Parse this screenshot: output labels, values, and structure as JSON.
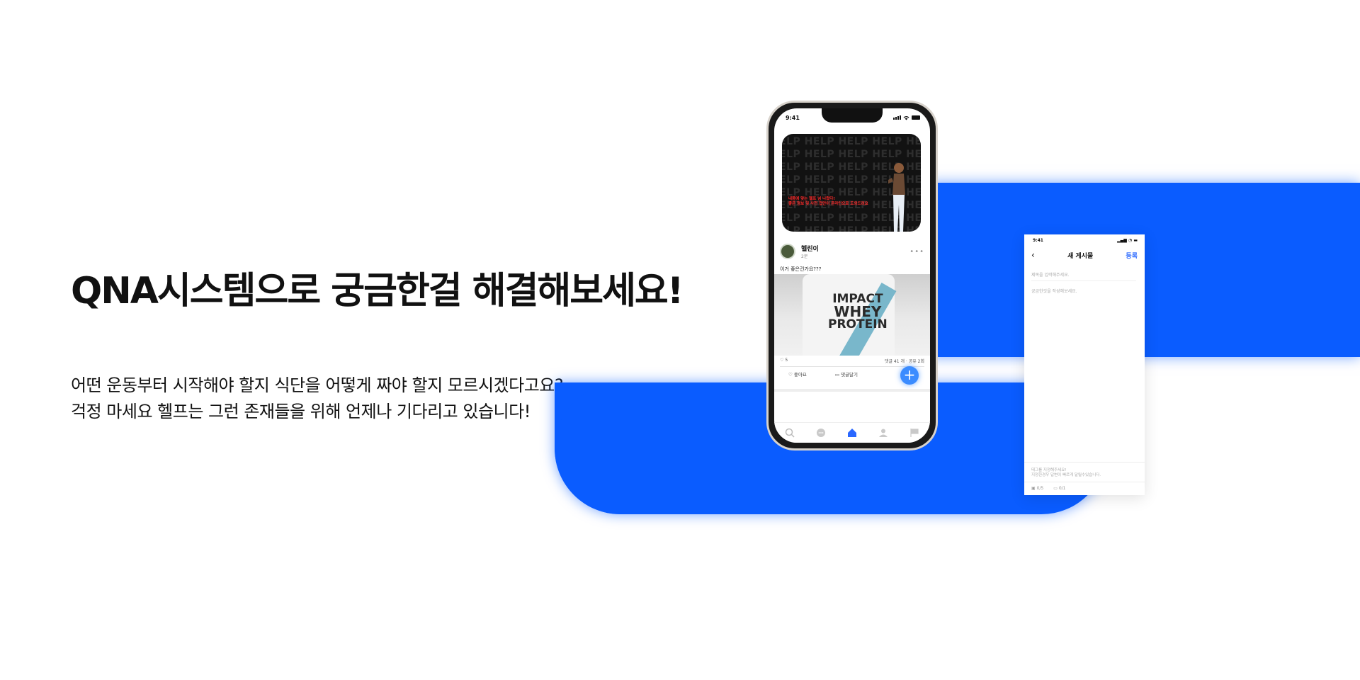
{
  "headline": "QNA시스템으로 궁금한걸 해결해보세요!",
  "description": {
    "line1": "어떤 운동부터 시작해야 할지 식단을 어떻게 짜야 할지 모르시겠다고요?",
    "line2": "걱정 마세요 헬프는 그런 존재들을 위해 언제나 기다리고 있습니다!"
  },
  "colors": {
    "brand_blue": "#0a5cff",
    "fab_blue": "#3b8cff",
    "link_blue": "#2a68ff"
  },
  "phone": {
    "status_time": "9:41",
    "banner": {
      "pattern_text": "ELP HELP HELP HELP HEL",
      "red_line1": "내몸에 맞는 헬프 넘 나왔다!",
      "red_line2": "좋은 정보 및 사전 접안이 온라인으로 도와드려요"
    },
    "post": {
      "author": "헬린이",
      "time": "2분",
      "text": "이거 좋은건가요???",
      "image_text": [
        "IMPACT",
        "WHEY",
        "PROTEIN"
      ],
      "like_count": "5",
      "stats": "댓글 41 개 · 공유 2회",
      "like_label": "좋아요",
      "comment_label": "댓글달기"
    },
    "fab_label": "+",
    "nav_icons": [
      "search-icon",
      "chat-icon",
      "home-icon",
      "profile-icon",
      "flag-icon"
    ]
  },
  "new_post": {
    "status_time": "9:41",
    "title": "새 게시물",
    "submit": "등록",
    "title_placeholder": "제목을 입력해주세요.",
    "body_placeholder": "궁금한것을 작성해보세요.",
    "footer_line1": "태그를 지정해주세요!",
    "footer_line2": "지정한경우 답변이 빠르게 달릴수있습니다.",
    "photo_count": "0/5",
    "video_count": "0/1"
  }
}
